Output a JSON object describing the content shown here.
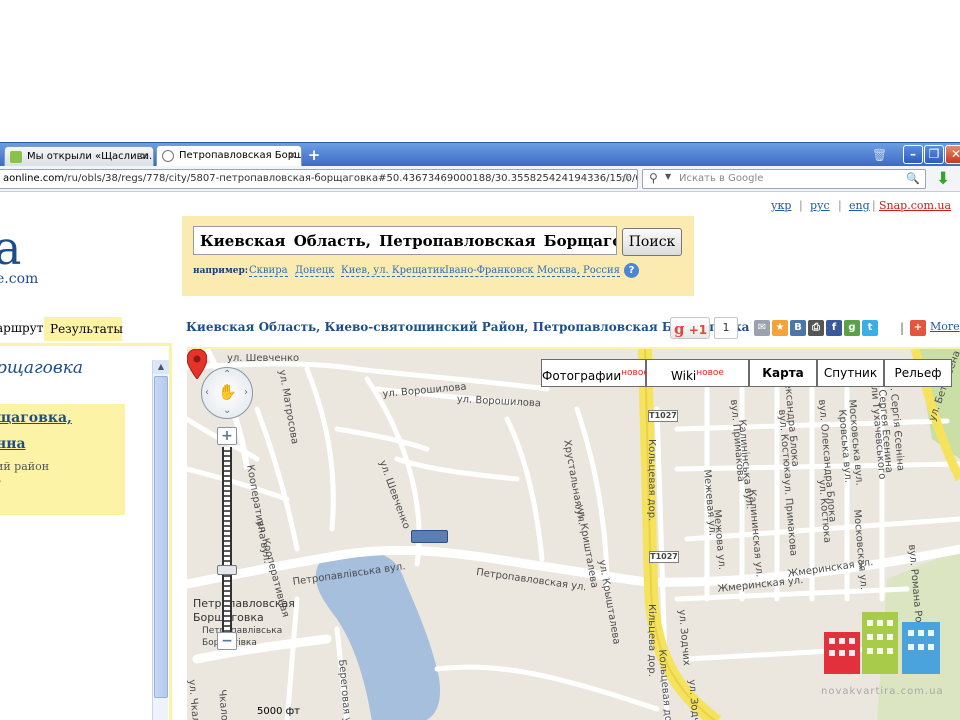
{
  "browser": {
    "tabs": [
      {
        "label": "Мы открыли «Щасливи...",
        "active": false
      },
      {
        "label": "Петропавловская Борщ...",
        "active": true
      }
    ],
    "new_tab": "+",
    "close_glyph": "✕",
    "url_host": "aonline.com",
    "url_path": "/ru/obls/38/regs/778/city/5807-петропавловская-борщаговка#50.43673469000188/30.355825424194336/15/0/0/0",
    "search_placeholder": "Искать в Google",
    "window_buttons": {
      "minimize": "–",
      "maximize": "❐",
      "close": "✕"
    }
  },
  "header": {
    "languages": [
      "укр",
      "рус",
      "eng"
    ],
    "separator": "|",
    "snap_link": "Snap.com.ua",
    "logo_letter": "a",
    "logo_domain": "e.com"
  },
  "search": {
    "value": "Киевская  Область, Петропавловская   Борщагові",
    "button": "Поиск",
    "example_label": "например:",
    "examples": [
      "Сквира",
      "Донецк",
      "Киев, ул. Крещатик",
      "Івано-Франковск",
      "Москва, Россия"
    ],
    "help": "?"
  },
  "left": {
    "tab_route": "аршрут",
    "tab_results": "Результаты",
    "title": "рщаговка",
    "link1": "щаговка,",
    "link2": "нна",
    "sub1": "ий район",
    "sub2": "°"
  },
  "breadcrumb": "Киевская Область, Киево-святошинский Район, Петропавловская Борщаговка",
  "social": {
    "gplus": "+1",
    "gplus_g": "g",
    "count": "1",
    "more": "More",
    "icons": [
      {
        "name": "mail-icon",
        "glyph": "✉",
        "color": "#9aa3ad"
      },
      {
        "name": "favorite-icon",
        "glyph": "★",
        "color": "#f2a33a"
      },
      {
        "name": "vkontakte-icon",
        "glyph": "B",
        "color": "#4a76a8"
      },
      {
        "name": "print-icon",
        "glyph": "⎙",
        "color": "#555555"
      },
      {
        "name": "facebook-icon",
        "glyph": "f",
        "color": "#3b5998"
      },
      {
        "name": "google-bookmark-icon",
        "glyph": "g",
        "color": "#5aa14a"
      },
      {
        "name": "twitter-icon",
        "glyph": "t",
        "color": "#3aaee6"
      }
    ],
    "addthis": "+"
  },
  "map": {
    "types": [
      {
        "label": "Фотографии",
        "badge": "новое",
        "selected": false
      },
      {
        "label": "Wiki",
        "badge": "новое",
        "selected": false
      },
      {
        "label": "Карта",
        "badge": "",
        "selected": true
      },
      {
        "label": "Спутник",
        "badge": "",
        "selected": false
      },
      {
        "label": "Рельеф",
        "badge": "",
        "selected": false
      }
    ],
    "zoom_in": "+",
    "zoom_out": "−",
    "scale": "5000 фт",
    "place_name_1": "Петропавловская",
    "place_name_2": "Борщаговка",
    "place_sub_1": "Петропавлівська",
    "place_sub_2": "Борщагівка",
    "road_shield_1": "T1027",
    "road_shield_2": "T1027",
    "streets": [
      "ул. Шевченко",
      "ул. Ворошилова",
      "ул. Ворошилова",
      "ул. Матросова",
      "ул. Шевченко",
      "Кооперативна вул.",
      "ул. Кооперативная",
      "Петропавлівська вул.",
      "Петропавловская ул.",
      "Хрустальная ул.",
      "ул. Кришталева",
      "ул. Крышталева",
      "Кольцевая дор.",
      "Кільцева дор.",
      "Кольцевая дор.",
      "Жмеринская ул.",
      "Жмеринская ул.",
      "ул. Зодчих",
      "ул. Зодчих",
      "Межевая ул.",
      "Межова ул.",
      "вул. Примакова",
      "ул. Примакова",
      "Калинінська вул.",
      "Калининская ул.",
      "вул. Костюка",
      "ул. Костюка",
      "Александра Блока",
      "вул. Олександра Блока",
      "Кровська вул.",
      "Московська вул.",
      "Московская ул.",
      "Миколи Тухачевського",
      "Сергея Есенина",
      "вул. Сергія Єсеніна",
      "ул. Бетховена",
      "вул. Романа Роллана",
      "ул. Чкалова",
      "Чкалова",
      "Береговая ул."
    ]
  },
  "watermark": "novakvartira.com.ua"
}
